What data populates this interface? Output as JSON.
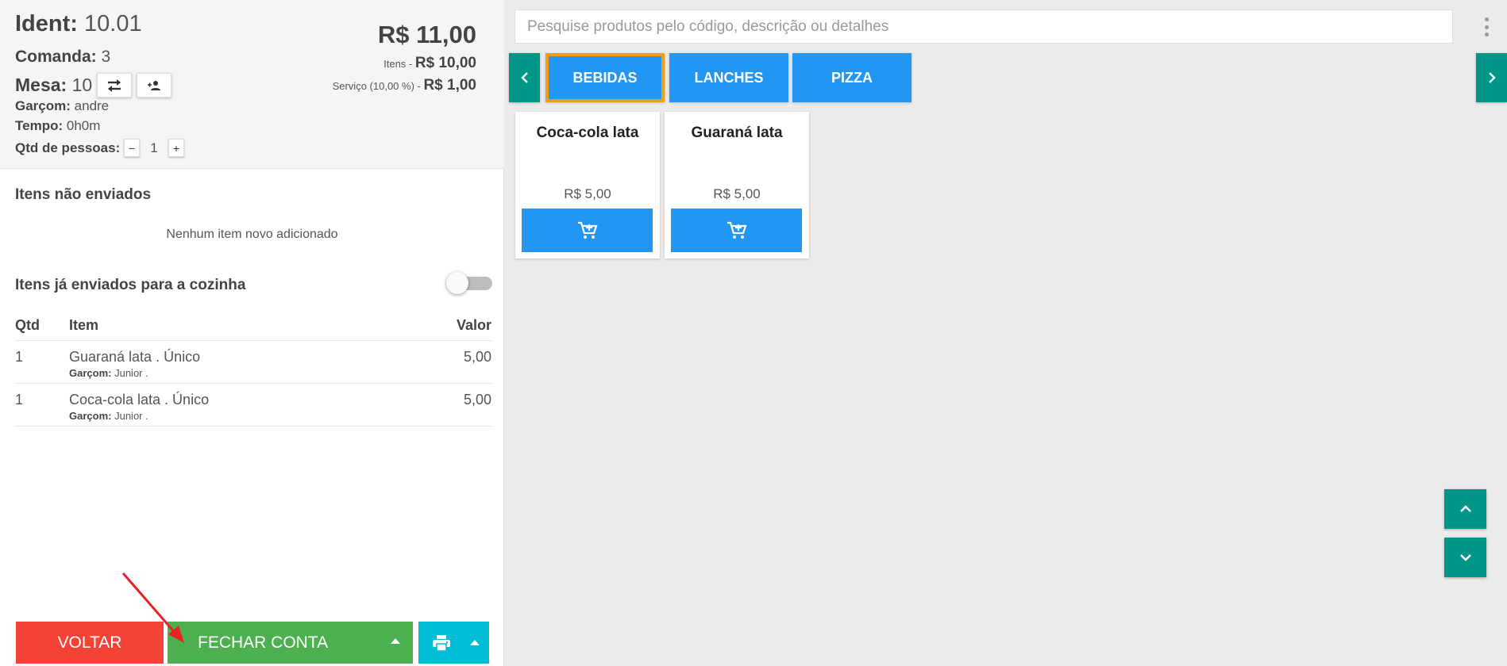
{
  "header": {
    "ident_label": "Ident:",
    "ident_value": "10.01",
    "comanda_label": "Comanda:",
    "comanda_value": "3",
    "mesa_label": "Mesa:",
    "mesa_value": "10",
    "garcom_label": "Garçom:",
    "garcom_value": "andre",
    "tempo_label": "Tempo:",
    "tempo_value": "0h0m",
    "pessoas_label": "Qtd de pessoas:",
    "pessoas_minus": "−",
    "pessoas_value": "1",
    "pessoas_plus": "+",
    "total": "R$ 11,00",
    "itens_label": "Itens - ",
    "itens_value": "R$ 10,00",
    "servico_label": "Serviço (10,00 %) - ",
    "servico_value": "R$ 1,00"
  },
  "unsent": {
    "title": "Itens não enviados",
    "empty_message": "Nenhum item novo adicionado"
  },
  "sent": {
    "title": "Itens já enviados para a cozinha",
    "toggle_on": false,
    "columns": {
      "qtd": "Qtd",
      "item": "Item",
      "valor": "Valor"
    },
    "rows": [
      {
        "qtd": "1",
        "item": "Guaraná lata . Único",
        "garcom_label": "Garçom:",
        "garcom": "Junior .",
        "valor": "5,00"
      },
      {
        "qtd": "1",
        "item": "Coca-cola lata . Único",
        "garcom_label": "Garçom:",
        "garcom": "Junior .",
        "valor": "5,00"
      }
    ]
  },
  "footer": {
    "voltar": "VOLTAR",
    "fechar": "FECHAR CONTA"
  },
  "search": {
    "placeholder": "Pesquise produtos pelo código, descrição ou detalhes"
  },
  "categories": [
    {
      "label": "BEBIDAS",
      "selected": true
    },
    {
      "label": "LANCHES",
      "selected": false
    },
    {
      "label": "PIZZA",
      "selected": false
    }
  ],
  "products": [
    {
      "name": "Coca-cola lata",
      "price": "R$ 5,00"
    },
    {
      "name": "Guaraná lata",
      "price": "R$ 5,00"
    }
  ],
  "colors": {
    "primary_blue": "#2196f3",
    "teal": "#009688",
    "red": "#f44336",
    "green": "#4caf50",
    "cyan": "#00bcd4",
    "selected_border": "#f39c12",
    "annotation_arrow": "#e8231f"
  },
  "icons": {
    "transfer": "swap-arrows-icon",
    "add_person": "person-add-icon",
    "print": "printer-icon",
    "cart": "add-to-cart-icon",
    "menu": "kebab-menu-icon"
  }
}
